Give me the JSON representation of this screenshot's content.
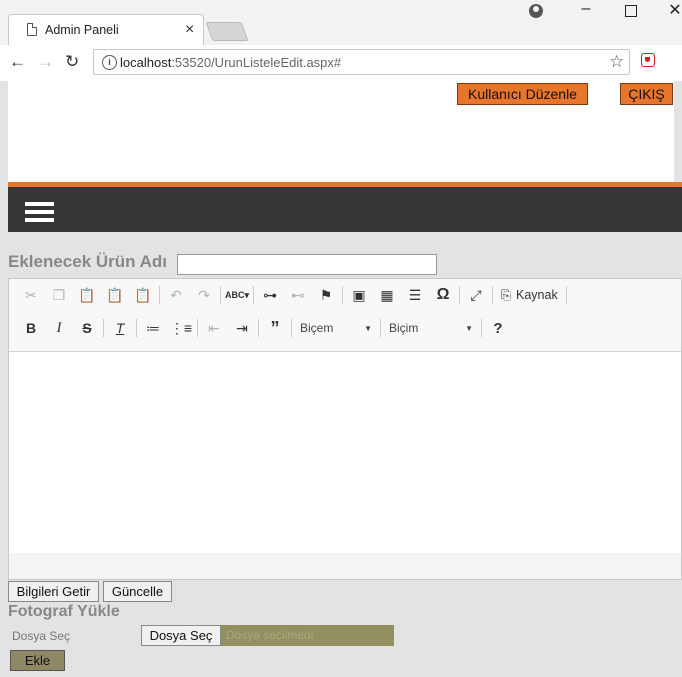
{
  "browser": {
    "tab_title": "Admin Paneli",
    "tab_close": "×",
    "url_host": "localhost",
    "url_rest": ":53520/UrunListeleEdit.aspx#",
    "info": "i",
    "star": "☆",
    "menu": "⋮",
    "back": "←",
    "forward": "→",
    "reload": "↻",
    "minimize": "–",
    "close": "✕"
  },
  "header": {
    "user_edit_button": "Kullanıcı Düzenle",
    "logout_button": "ÇIKIŞ",
    "accent_color": "#e8752c",
    "nav_color": "#363636"
  },
  "form": {
    "product_name_label": "Eklenecek Ürün Adı",
    "product_name_value": "",
    "fetch_button": "Bilgileri Getir",
    "update_button": "Güncelle",
    "photo_title": "Fotograf Yükle",
    "file_label": "Dosya Seç",
    "file_button": "Dosya Seç",
    "file_status": "Dosya seçilmedi",
    "add_button": "Ekle"
  },
  "editor": {
    "source_label": "Kaynak",
    "style_combo": "Biçem",
    "format_combo": "Biçim",
    "help": "?",
    "toolbar_row1": [
      "cut-icon",
      "copy-icon",
      "paste-icon",
      "paste-text-icon",
      "paste-word-icon",
      "undo-icon",
      "redo-icon",
      "spellcheck-icon",
      "link-icon",
      "unlink-icon",
      "anchor-icon",
      "image-icon",
      "table-icon",
      "horizontal-rule-icon",
      "special-char-icon",
      "maximize-icon",
      "source-icon"
    ],
    "toolbar_row2": [
      "bold-icon",
      "italic-icon",
      "strike-icon",
      "remove-format-icon",
      "numbered-list-icon",
      "bulleted-list-icon",
      "outdent-icon",
      "indent-icon",
      "blockquote-icon"
    ]
  }
}
